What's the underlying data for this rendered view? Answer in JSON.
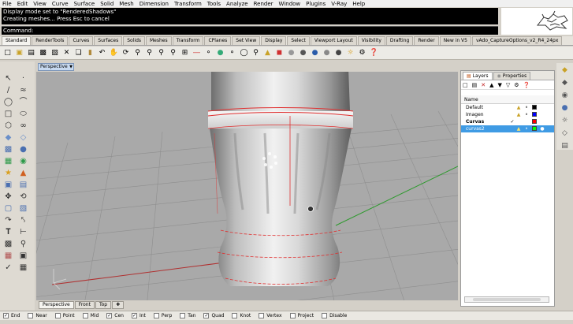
{
  "menu": [
    "File",
    "Edit",
    "View",
    "Curve",
    "Surface",
    "Solid",
    "Mesh",
    "Dimension",
    "Transform",
    "Tools",
    "Analyze",
    "Render",
    "Window",
    "Plugins",
    "V-Ray",
    "Help"
  ],
  "command": {
    "history": [
      "Display mode set to \"RenderedShadows\"",
      "Creating meshes... Press Esc to cancel"
    ],
    "prompt": "Command:"
  },
  "toolbar_tabs": [
    "Standard",
    "RenderTools",
    "Curves",
    "Surfaces",
    "Solids",
    "Meshes",
    "Transform",
    "CPlanes",
    "Set View",
    "Display",
    "Select",
    "Viewport Layout",
    "Visibility",
    "Drafting",
    "Render",
    "New in V5",
    "vAdo_CaptureOptions_v2_R4_24px"
  ],
  "toolbar_icons": [
    "new-file",
    "open",
    "save",
    "print",
    "import",
    "cut",
    "copy",
    "paste",
    "undo",
    "pan",
    "rotate-view",
    "zoom",
    "zoom-window",
    "zoom-extents",
    "zoom-selected",
    "4-view",
    "select-window",
    "hide",
    "show",
    "lock",
    "point-off",
    "ortho",
    "lighting",
    "color",
    "rendered",
    "material",
    "render",
    "environment",
    "shadow",
    "sun",
    "settings",
    "help"
  ],
  "left_tools_count": 34,
  "viewport": {
    "title": "Perspective",
    "tabs": [
      "Perspective",
      "Front",
      "Top"
    ]
  },
  "panel": {
    "tabs": [
      "Layers",
      "Properties"
    ],
    "column_header": "Name",
    "layers": [
      {
        "name": "Default",
        "color": "#000000",
        "current": false,
        "selected": false
      },
      {
        "name": "Imagen",
        "color": "#0000ff",
        "current": false,
        "selected": false
      },
      {
        "name": "Curvas",
        "color": "#ff0000",
        "current": true,
        "selected": false
      },
      {
        "name": "curvas2",
        "color": "#00ff00",
        "current": false,
        "selected": true
      }
    ]
  },
  "osnaps": [
    {
      "label": "End",
      "checked": true
    },
    {
      "label": "Near",
      "checked": false
    },
    {
      "label": "Point",
      "checked": false
    },
    {
      "label": "Mid",
      "checked": false
    },
    {
      "label": "Cen",
      "checked": true
    },
    {
      "label": "Int",
      "checked": true
    },
    {
      "label": "Perp",
      "checked": false
    },
    {
      "label": "Tan",
      "checked": false
    },
    {
      "label": "Quad",
      "checked": true
    },
    {
      "label": "Knot",
      "checked": false
    },
    {
      "label": "Vertex",
      "checked": false
    },
    {
      "label": "Project",
      "checked": false
    },
    {
      "label": "Disable",
      "checked": false
    }
  ],
  "colors": {
    "viewport_bg": "#a9a9a9",
    "grid": "#8f8f8f",
    "x_axis": "#b03030",
    "y_axis": "#2f9a2f",
    "curve": "#e03030",
    "selection": "#3f9be4"
  }
}
